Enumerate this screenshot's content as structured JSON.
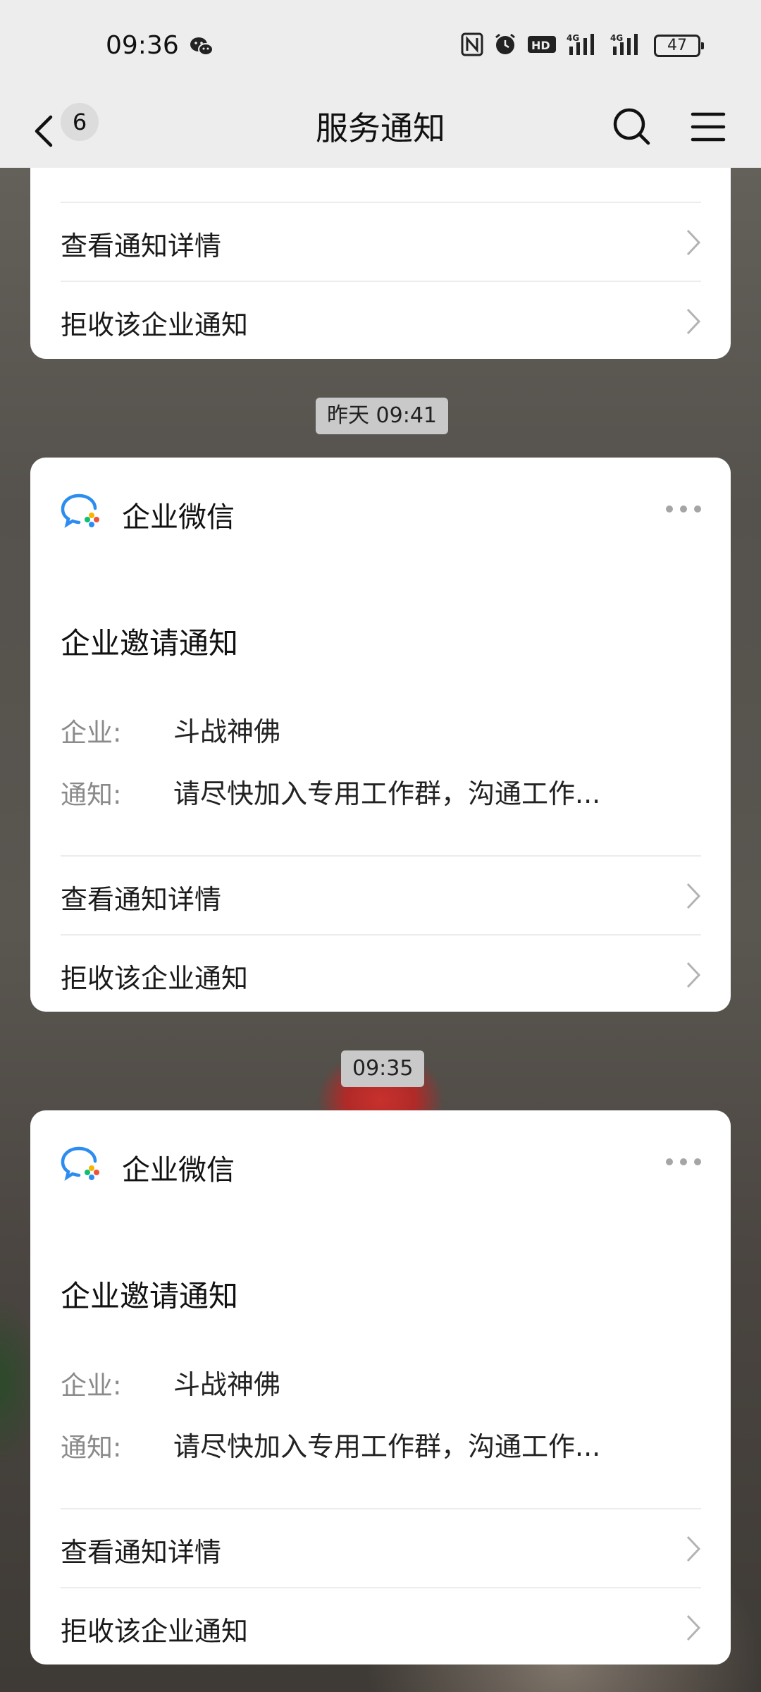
{
  "status_bar": {
    "time": "09:36",
    "battery": "47",
    "net1": "4G",
    "net2": "4G",
    "hd": "HD"
  },
  "nav": {
    "back_count": "6",
    "title": "服务通知"
  },
  "top_card": {
    "link_details": "查看通知详情",
    "link_reject": "拒收该企业通知"
  },
  "messages": [
    {
      "timestamp": "昨天 09:41",
      "app_name": "企业微信",
      "title": "企业邀请通知",
      "fields": [
        {
          "label": "企业:",
          "value": "斗战神佛"
        },
        {
          "label": "通知:",
          "value": "请尽快加入专用工作群，沟通工作..."
        }
      ],
      "link_details": "查看通知详情",
      "link_reject": "拒收该企业通知"
    },
    {
      "timestamp": "09:35",
      "app_name": "企业微信",
      "title": "企业邀请通知",
      "fields": [
        {
          "label": "企业:",
          "value": "斗战神佛"
        },
        {
          "label": "通知:",
          "value": "请尽快加入专用工作群，沟通工作..."
        }
      ],
      "link_details": "查看通知详情",
      "link_reject": "拒收该企业通知"
    }
  ],
  "colors": {
    "bar_bg": "#ededed",
    "card_bg": "#ffffff",
    "timestamp_bg": "#c9c9c9"
  }
}
